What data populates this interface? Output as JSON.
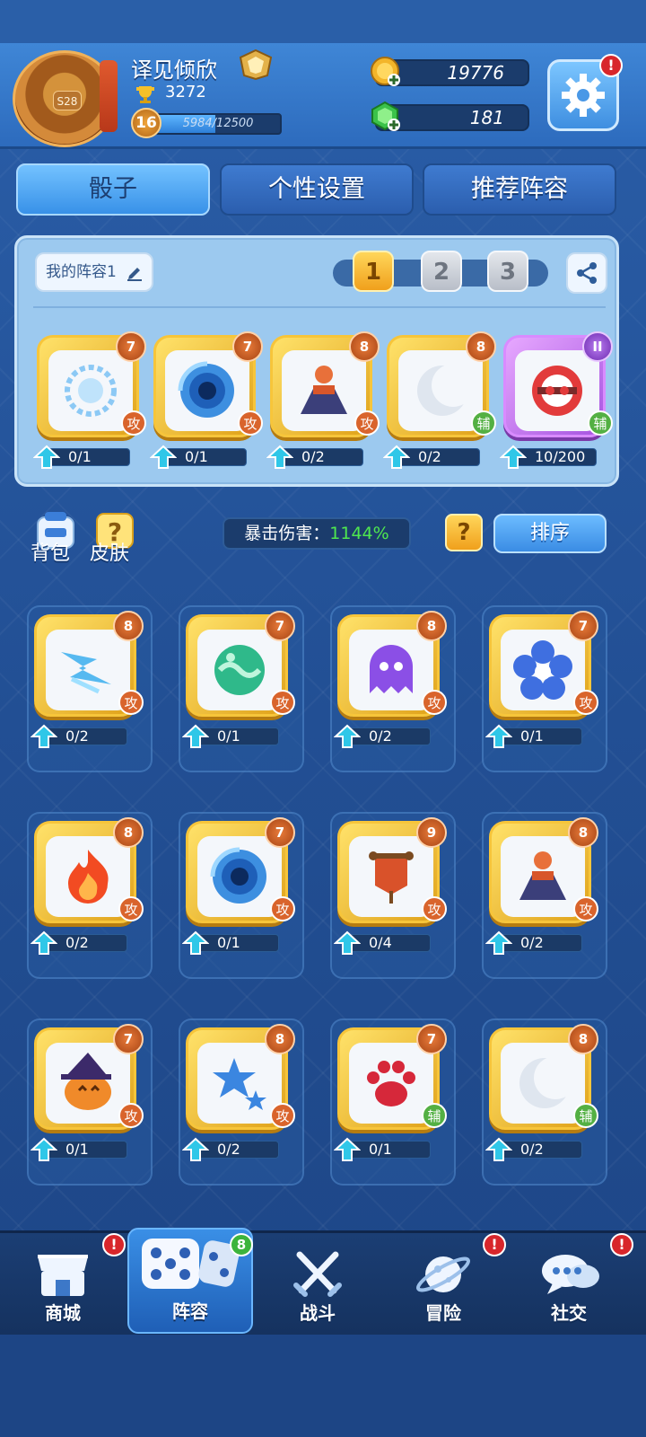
{
  "player": {
    "name": "译见倾欣",
    "rank_badge": "S28",
    "trophies": "3272",
    "level": "16",
    "xp_text": "5984/12500",
    "xp_progress": 0.479
  },
  "currency": {
    "gold": "19776",
    "gems": "181"
  },
  "alerts": {
    "mark": "!"
  },
  "tabs": {
    "dice": "骰子",
    "personal": "个性设置",
    "recommended": "推荐阵容"
  },
  "deck": {
    "name": "我的阵容1",
    "slots": [
      "1",
      "2",
      "3"
    ],
    "active_slot": "1",
    "cards": [
      {
        "icon": "sun-dice-icon",
        "level": "7",
        "type": "攻",
        "progress": "0/1"
      },
      {
        "icon": "vortex-dice-icon",
        "level": "7",
        "type": "攻",
        "progress": "0/1"
      },
      {
        "icon": "volcano-dice-icon",
        "level": "8",
        "type": "攻",
        "progress": "0/2"
      },
      {
        "icon": "moon-dice-icon",
        "level": "8",
        "type": "辅",
        "progress": "0/2"
      },
      {
        "icon": "crossbow-dice-icon",
        "level": "II",
        "type": "辅",
        "progress": "10/200"
      }
    ]
  },
  "toolbar": {
    "bag": "背包",
    "skin": "皮肤",
    "crit_label": "暴击伤害：",
    "crit_value": "1144%",
    "help": "?",
    "sort": "排序"
  },
  "collection": [
    {
      "icon": "lightning-dice-icon",
      "level": "8",
      "type": "攻",
      "progress": "0/2"
    },
    {
      "icon": "poison-dice-icon",
      "level": "7",
      "type": "攻",
      "progress": "0/1"
    },
    {
      "icon": "ghost-dice-icon",
      "level": "8",
      "type": "攻",
      "progress": "0/2"
    },
    {
      "icon": "ice-flower-dice-icon",
      "level": "7",
      "type": "攻",
      "progress": "0/1"
    },
    {
      "icon": "fire-dice-icon",
      "level": "8",
      "type": "攻",
      "progress": "0/2"
    },
    {
      "icon": "vortex-dice-icon",
      "level": "7",
      "type": "攻",
      "progress": "0/1"
    },
    {
      "icon": "banner-dice-icon",
      "level": "9",
      "type": "攻",
      "progress": "0/4"
    },
    {
      "icon": "volcano-dice-icon",
      "level": "8",
      "type": "攻",
      "progress": "0/2"
    },
    {
      "icon": "pumpkin-dice-icon",
      "level": "7",
      "type": "攻",
      "progress": "0/1"
    },
    {
      "icon": "star-dice-icon",
      "level": "8",
      "type": "攻",
      "progress": "0/2"
    },
    {
      "icon": "paw-dice-icon",
      "level": "7",
      "type": "辅",
      "progress": "0/1"
    },
    {
      "icon": "moon-dice-icon",
      "level": "8",
      "type": "辅",
      "progress": "0/2"
    }
  ],
  "nav": {
    "shop": "商城",
    "deck": "阵容",
    "deck_badge": "8",
    "battle": "战斗",
    "adventure": "冒险",
    "social": "社交"
  }
}
